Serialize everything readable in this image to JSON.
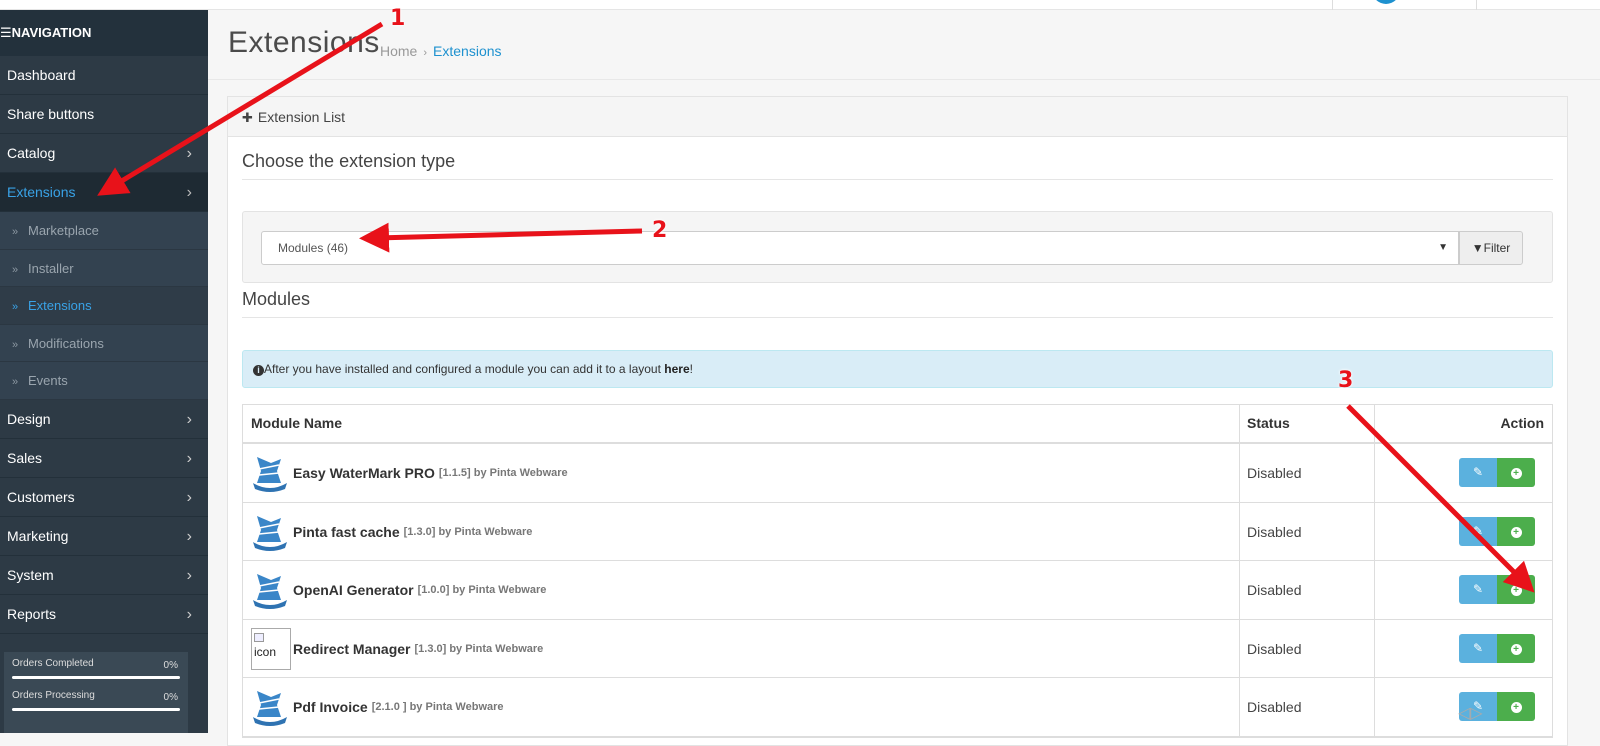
{
  "sidebar": {
    "header": "NAVIGATION",
    "items": [
      {
        "label": "Dashboard",
        "chevron": false
      },
      {
        "label": "Share buttons",
        "chevron": false
      },
      {
        "label": "Catalog",
        "chevron": true
      },
      {
        "label": "Extensions",
        "chevron": true,
        "active": true
      }
    ],
    "sub_items": [
      {
        "label": "Marketplace"
      },
      {
        "label": "Installer"
      },
      {
        "label": "Extensions",
        "active": true
      },
      {
        "label": "Modifications"
      },
      {
        "label": "Events"
      }
    ],
    "items_after": [
      {
        "label": "Design"
      },
      {
        "label": "Sales"
      },
      {
        "label": "Customers"
      },
      {
        "label": "Marketing"
      },
      {
        "label": "System"
      },
      {
        "label": "Reports"
      }
    ],
    "progress": [
      {
        "label": "Orders Completed",
        "value": "0%"
      },
      {
        "label": "Orders Processing",
        "value": "0%"
      }
    ]
  },
  "header": {
    "title": "Extensions",
    "breadcrumb": [
      "Home",
      "Extensions"
    ]
  },
  "panel": {
    "heading": "Extension List",
    "choose_title": "Choose the extension type",
    "select_value": "Modules (46)",
    "filter_label": "Filter",
    "section_title": "Modules",
    "alert_text": "After you have installed and configured a module you can add it to a layout ",
    "alert_link": "here",
    "alert_end": "!"
  },
  "table": {
    "headers": {
      "name": "Module Name",
      "status": "Status",
      "action": "Action"
    },
    "rows": [
      {
        "name": "Easy WaterMark PRO",
        "version": "[1.1.5] by Pinta Webware",
        "status": "Disabled",
        "logo": "ship"
      },
      {
        "name": "Pinta fast cache",
        "version": "[1.3.0] by Pinta Webware",
        "status": "Disabled",
        "logo": "ship"
      },
      {
        "name": "OpenAI Generator",
        "version": "[1.0.0] by Pinta Webware",
        "status": "Disabled",
        "logo": "ship"
      },
      {
        "name": "Redirect Manager",
        "version": "[1.3.0] by Pinta Webware",
        "status": "Disabled",
        "logo": "broken",
        "alt": "icon"
      },
      {
        "name": "Pdf Invoice",
        "version": "[2.1.0 ] by Pinta Webware",
        "status": "Disabled",
        "logo": "ship"
      }
    ]
  },
  "annotations": {
    "numbers": [
      "1",
      "2",
      "3"
    ],
    "color": "#e8121a"
  },
  "colors": {
    "sidebar_bg": "#2d3a45",
    "accent": "#1e91cf",
    "edit_btn": "#5bb1de",
    "install_btn": "#4cae4c",
    "alert_bg": "#d9edf7"
  }
}
